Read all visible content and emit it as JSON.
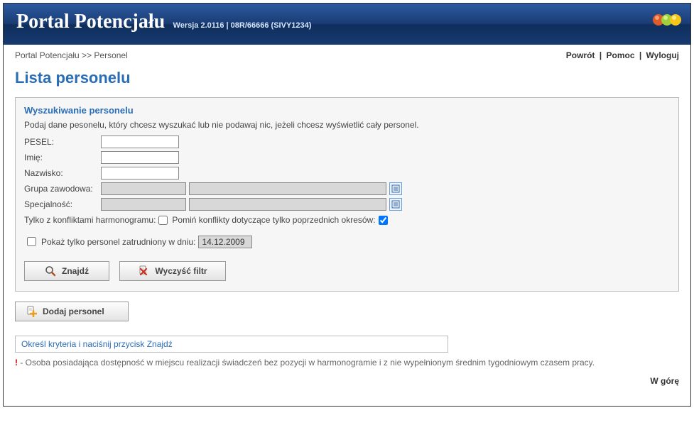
{
  "header": {
    "title": "Portal Potencjału",
    "version": "Wersja 2.0116 | 08R/66666 (SIVY1234)"
  },
  "breadcrumb": "Portal Potencjału >> Personel",
  "toplinks": {
    "back": "Powrót",
    "help": "Pomoc",
    "logout": "Wyloguj"
  },
  "page_title": "Lista personelu",
  "search": {
    "heading": "Wyszukiwanie personelu",
    "description": "Podaj dane pesonelu, który chcesz wyszukać lub nie podawaj nic, jeżeli chcesz wyświetlić cały personel.",
    "labels": {
      "pesel": "PESEL:",
      "imie": "Imię:",
      "nazwisko": "Nazwisko:",
      "grupa": "Grupa zawodowa:",
      "specjalnosc": "Specjalność:"
    },
    "conflict_label": "Tylko z konfliktami harmonogramu:",
    "skip_prev_label": "Pomiń konflikty dotyczące tylko poprzednich okresów:",
    "conflict_checked": false,
    "skip_prev_checked": true,
    "only_date_label": "Pokaż tylko personel zatrudniony w dniu:",
    "only_date_checked": false,
    "date_value": "14.12.2009",
    "find_label": "Znajdź",
    "clear_label": "Wyczyść filtr"
  },
  "add_personnel_label": "Dodaj personel",
  "info_box": "Określ kryteria i naciśnij przycisk Znajdź",
  "note_text": " - Osoba posiadająca dostępność w miejscu realizacji świadczeń bez pozycji w harmonogramie i z nie wypełnionym średnim tygodniowym czasem pracy.",
  "footer_up": "W górę"
}
